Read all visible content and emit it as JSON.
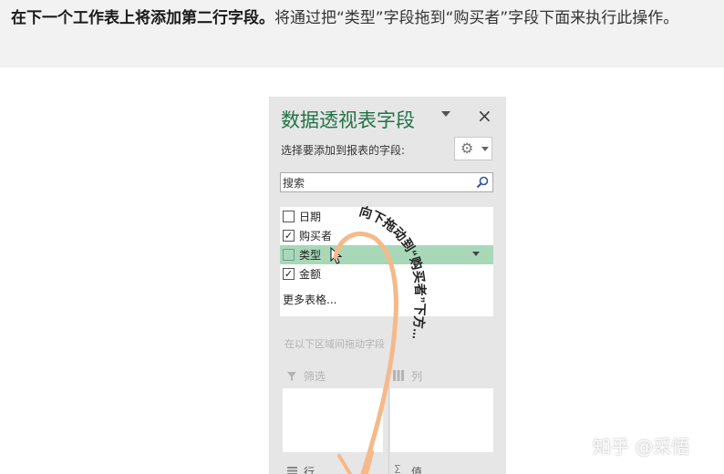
{
  "header": {
    "bold_text": "在下一个工作表上将添加第二行字段。",
    "normal_text": "将通过把“类型”字段拖到“购买者”字段下面来执行此操作。"
  },
  "panel": {
    "title": "数据透视表字段",
    "close_glyph": "×",
    "choose_label": "选择要添加到报表的字段:",
    "gear_glyph": "⚙",
    "search_placeholder": "搜索",
    "fields": [
      {
        "label": "日期",
        "checked": false,
        "check": ""
      },
      {
        "label": "购买者",
        "checked": true,
        "check": "✓"
      },
      {
        "label": "类型",
        "checked": false,
        "check": ""
      },
      {
        "label": "金额",
        "checked": true,
        "check": "✓"
      }
    ],
    "more_tables": "更多表格...",
    "drag_hint": "在以下区域间拖动字段",
    "areas": {
      "filter": "筛选",
      "columns": "列",
      "rows": "行",
      "values": "值",
      "sigma_glyph": "Σ"
    }
  },
  "annotation": {
    "drag_instruction": "向下拖动到“购买者”下方...",
    "arrow_color": "#f5b98a"
  },
  "watermark": "知乎 @采悟",
  "colors": {
    "accent_green": "#217346",
    "selected_row": "#a8d8b8",
    "panel_bg": "#e6e6e6",
    "header_band": "#f2f2f2"
  }
}
